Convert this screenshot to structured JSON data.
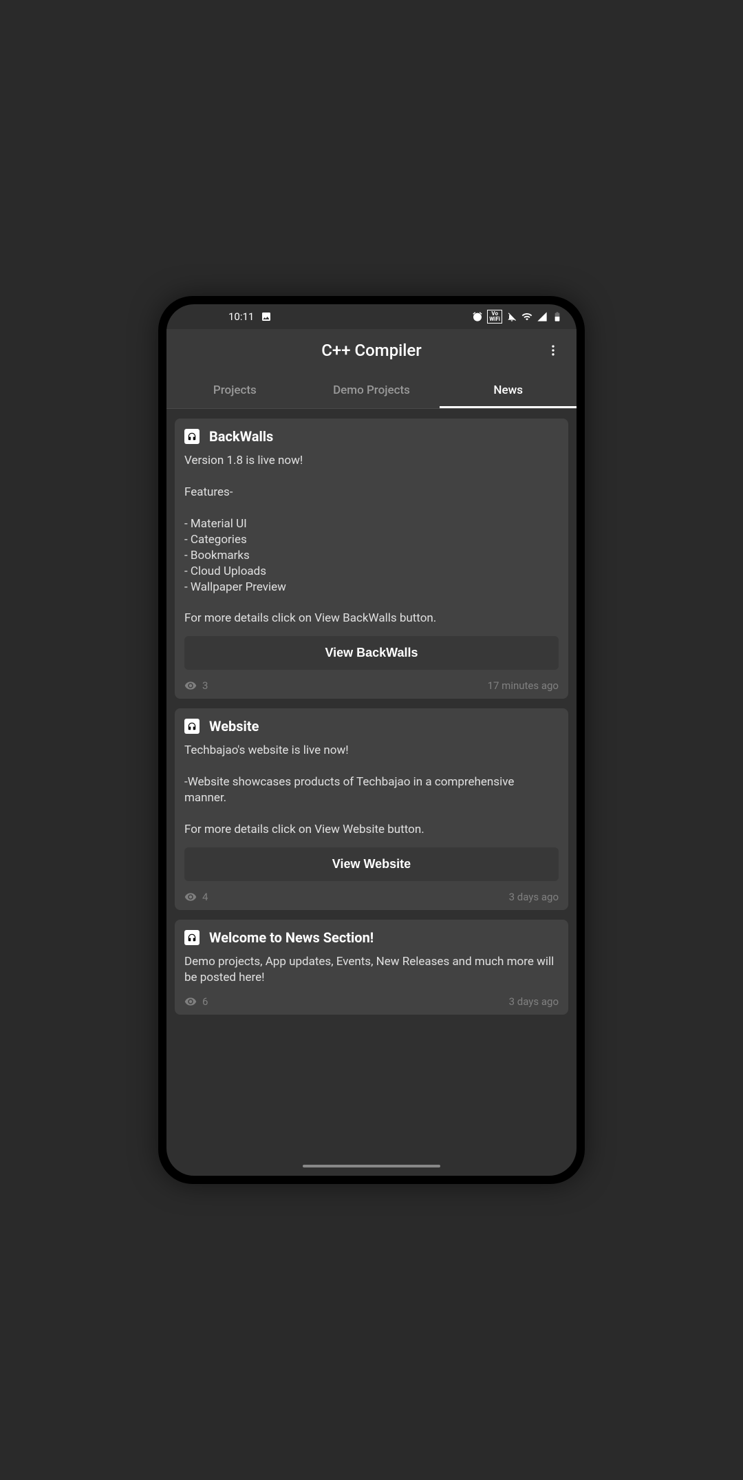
{
  "status_bar": {
    "time": "10:11"
  },
  "app_bar": {
    "title": "C++ Compiler"
  },
  "tabs": [
    {
      "label": "Projects",
      "active": false
    },
    {
      "label": "Demo Projects",
      "active": false
    },
    {
      "label": "News",
      "active": true
    }
  ],
  "news": [
    {
      "title": "BackWalls",
      "body": "Version 1.8 is live now!\n\nFeatures-\n\n- Material UI\n- Categories\n- Bookmarks\n- Cloud Uploads\n- Wallpaper Preview\n\nFor more details click on View BackWalls button.",
      "button": "View BackWalls",
      "views": "3",
      "time": "17 minutes ago"
    },
    {
      "title": "Website",
      "body": "Techbajao's website is live now!\n\n-Website showcases products of Techbajao in a comprehensive manner.\n\nFor more details click on View Website button.",
      "button": "View Website",
      "views": "4",
      "time": "3 days ago"
    },
    {
      "title": "Welcome to News Section!",
      "body": "Demo projects, App updates, Events, New Releases and much more will be posted here!",
      "button": null,
      "views": "6",
      "time": "3 days ago"
    }
  ]
}
